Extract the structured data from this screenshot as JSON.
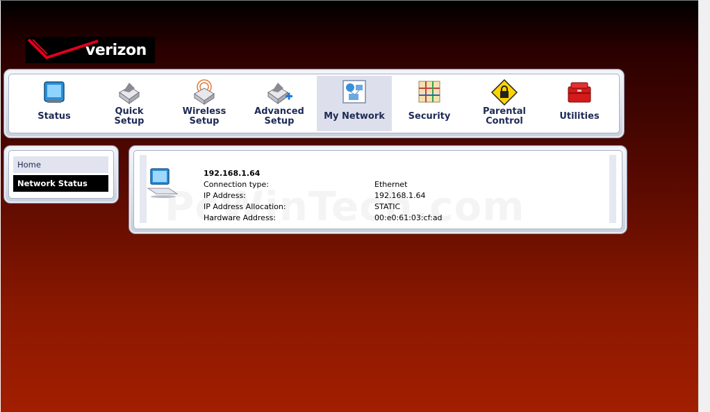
{
  "brand": {
    "logo_text": "verizon"
  },
  "nav": {
    "items": [
      {
        "label_l1": "Status",
        "label_l2": "",
        "icon": "status-icon"
      },
      {
        "label_l1": "Quick",
        "label_l2": "Setup",
        "icon": "quick-setup-icon"
      },
      {
        "label_l1": "Wireless",
        "label_l2": "Setup",
        "icon": "wireless-setup-icon"
      },
      {
        "label_l1": "Advanced",
        "label_l2": "Setup",
        "icon": "advanced-setup-icon"
      },
      {
        "label_l1": "My Network",
        "label_l2": "",
        "icon": "my-network-icon",
        "active": true
      },
      {
        "label_l1": "Security",
        "label_l2": "",
        "icon": "security-icon"
      },
      {
        "label_l1": "Parental",
        "label_l2": "Control",
        "icon": "parental-control-icon"
      },
      {
        "label_l1": "Utilities",
        "label_l2": "",
        "icon": "utilities-icon"
      }
    ]
  },
  "sidebar": {
    "items": [
      {
        "label": "Home"
      },
      {
        "label": "Network Status",
        "active": true
      }
    ]
  },
  "device": {
    "title": "192.168.1.64",
    "rows": [
      {
        "label": "Connection type:",
        "value": "Ethernet"
      },
      {
        "label": "IP Address:",
        "value": "192.168.1.64"
      },
      {
        "label": "IP Address Allocation:",
        "value": "STATIC"
      },
      {
        "label": "Hardware Address:",
        "value": "00:e0:61:03:cf:ad"
      }
    ]
  },
  "watermark": "PcWinTech.com",
  "colors": {
    "nav_text": "#1e2a55",
    "active_bg": "#dde0ec",
    "brand_red": "#e0001b"
  }
}
